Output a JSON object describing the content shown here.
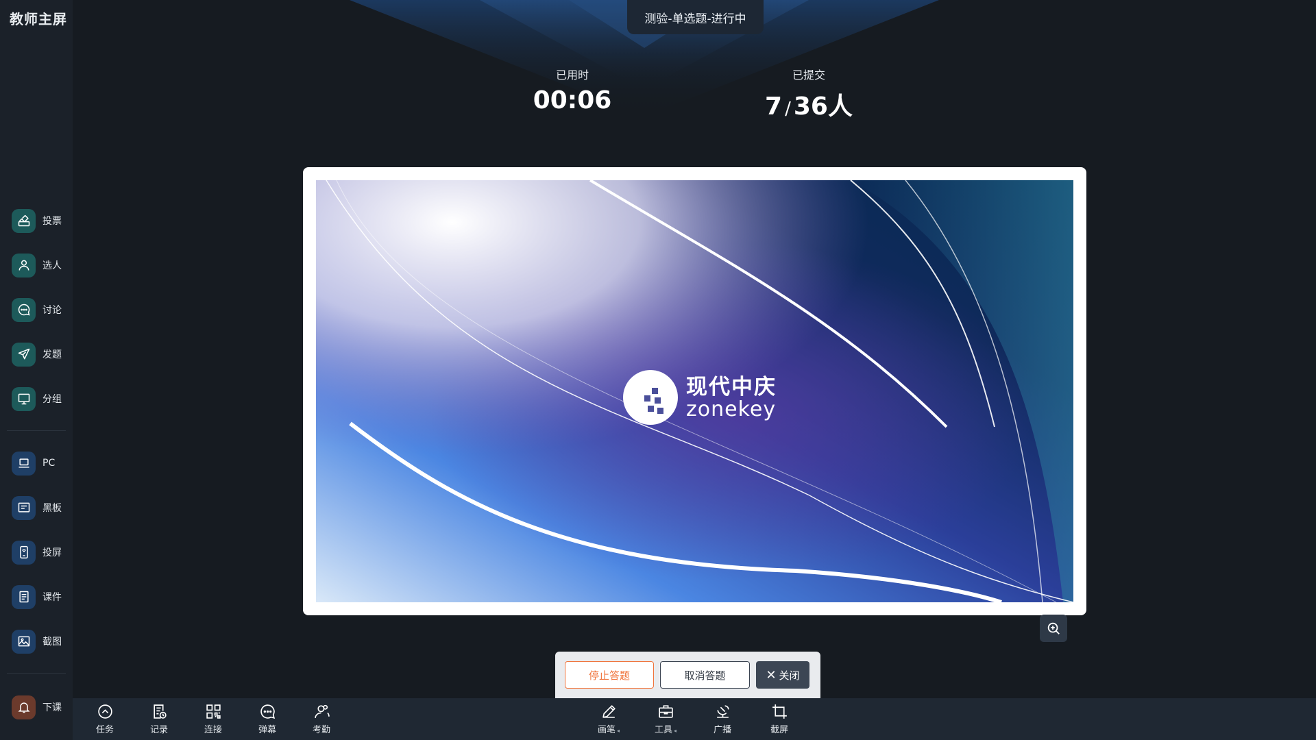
{
  "sidebar": {
    "title": "教师主屏",
    "top_items": [
      {
        "label": "投票",
        "icon": "vote-icon"
      },
      {
        "label": "选人",
        "icon": "person-icon"
      },
      {
        "label": "讨论",
        "icon": "chat-icon"
      },
      {
        "label": "发题",
        "icon": "send-icon"
      },
      {
        "label": "分组",
        "icon": "monitor-icon"
      }
    ],
    "device_items": [
      {
        "label": "PC",
        "icon": "laptop-icon"
      },
      {
        "label": "黑板",
        "icon": "blackboard-icon"
      },
      {
        "label": "投屏",
        "icon": "cast-screen-icon"
      },
      {
        "label": "课件",
        "icon": "courseware-icon"
      },
      {
        "label": "截图",
        "icon": "screenshot-image-icon"
      }
    ],
    "end_class": {
      "label": "下课",
      "icon": "bell-icon"
    }
  },
  "status": "测验-单选题-进行中",
  "stats": {
    "elapsed_label": "已用时",
    "elapsed_value": "00:06",
    "submitted_label": "已提交",
    "submitted_count": "7",
    "separator": "/",
    "submitted_total": "36人"
  },
  "preview": {
    "brand_cn": "现代中庆",
    "brand_en": "zonekey"
  },
  "answer_controls": {
    "stop": "停止答题",
    "cancel": "取消答题",
    "close": "关闭"
  },
  "bottom_left_tools": [
    {
      "label": "任务",
      "icon": "task-icon"
    },
    {
      "label": "记录",
      "icon": "record-icon"
    },
    {
      "label": "连接",
      "icon": "qr-connect-icon"
    },
    {
      "label": "弹幕",
      "icon": "danmaku-icon"
    },
    {
      "label": "考勤",
      "icon": "attendance-icon"
    }
  ],
  "bottom_right_tools": [
    {
      "label": "画笔",
      "icon": "pen-icon",
      "has_menu": true
    },
    {
      "label": "工具",
      "icon": "toolbox-icon",
      "has_menu": true
    },
    {
      "label": "广播",
      "icon": "broadcast-icon",
      "has_menu": false
    },
    {
      "label": "截屏",
      "icon": "crop-icon",
      "has_menu": false
    }
  ],
  "colors": {
    "background": "#161b21",
    "sidebar": "#1b2129",
    "accent_orange": "#f0743c",
    "teal_icon_bg": "#1d5a5a",
    "blue_icon_bg": "#1f3f66"
  }
}
